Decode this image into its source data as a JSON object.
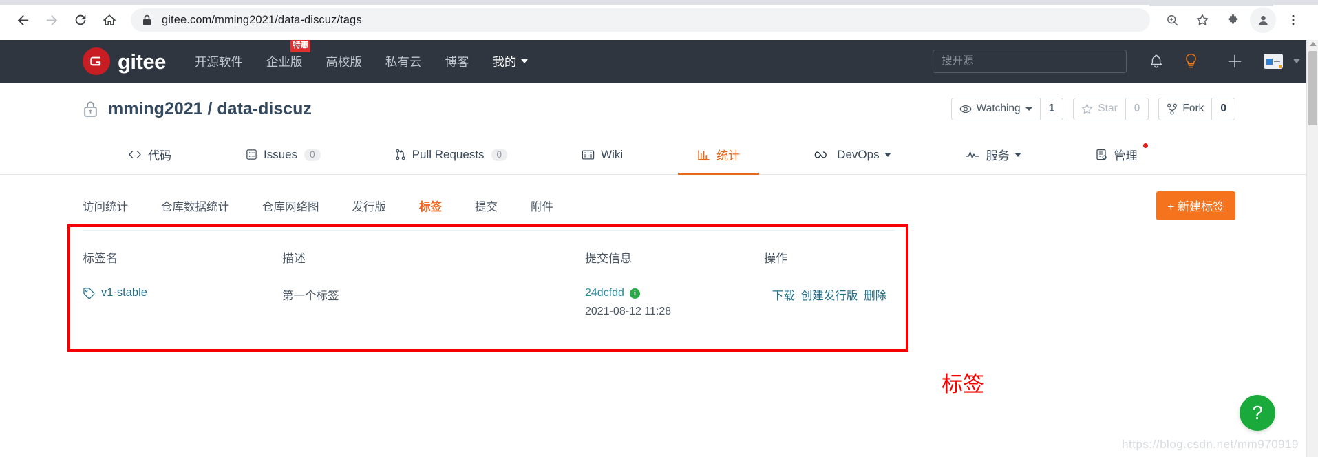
{
  "browser": {
    "back_icon": "back-arrow-icon",
    "forward_icon": "forward-arrow-icon",
    "reload_icon": "reload-icon",
    "home_icon": "home-icon",
    "lock_icon": "lock-icon",
    "url_domain": "gitee.com",
    "url_path": "/mming2021/data-discuz/tags",
    "url_full": "gitee.com/mming2021/data-discuz/tags",
    "toolbar_icons": [
      "zoom-in-icon",
      "bookmark-star-icon",
      "extensions-puzzle-icon",
      "profile-avatar-icon",
      "chrome-menu-icon"
    ]
  },
  "header": {
    "logo_letter": "G",
    "logo_text": "gitee",
    "nav": [
      {
        "label": "开源软件",
        "badge": null,
        "caret": false,
        "active": false
      },
      {
        "label": "企业版",
        "badge": "特惠",
        "caret": false,
        "active": false
      },
      {
        "label": "高校版",
        "badge": null,
        "caret": false,
        "active": false
      },
      {
        "label": "私有云",
        "badge": null,
        "caret": false,
        "active": false
      },
      {
        "label": "博客",
        "badge": null,
        "caret": false,
        "active": false
      },
      {
        "label": "我的",
        "badge": null,
        "caret": true,
        "active": true
      }
    ],
    "search_placeholder": "搜开源",
    "search_value": "",
    "icons": {
      "bell": "notification-bell-icon",
      "bulb": "lightbulb-icon",
      "plus": "plus-icon",
      "avatar": "user-avatar-icon",
      "avatar_caret": "chevron-down-icon"
    },
    "colors": {
      "bg": "#2f3640",
      "logo": "#c71d23",
      "bulb": "#f07a1a",
      "badge": "#e03030"
    }
  },
  "repo": {
    "lock_icon": "private-lock-icon",
    "owner": "mming2021",
    "separator": "/",
    "name": "data-discuz",
    "title_full": "mming2021 / data-discuz",
    "actions": [
      {
        "icon": "eye-icon",
        "label": "Watching",
        "caret": true,
        "count": "1",
        "disabled": false
      },
      {
        "icon": "star-icon",
        "label": "Star",
        "caret": false,
        "count": "0",
        "disabled": true
      },
      {
        "icon": "fork-icon",
        "label": "Fork",
        "caret": false,
        "count": "0",
        "disabled": false
      }
    ]
  },
  "tabs": [
    {
      "icon": "code-brackets-icon",
      "label": "代码",
      "count": null,
      "active": false,
      "caret": false,
      "dot": false
    },
    {
      "icon": "issues-icon",
      "label": "Issues",
      "count": "0",
      "active": false,
      "caret": false,
      "dot": false
    },
    {
      "icon": "pull-request-icon",
      "label": "Pull Requests",
      "count": "0",
      "active": false,
      "caret": false,
      "dot": false
    },
    {
      "icon": "wiki-book-icon",
      "label": "Wiki",
      "count": null,
      "active": false,
      "caret": false,
      "dot": false
    },
    {
      "icon": "bar-chart-icon",
      "label": "统计",
      "count": null,
      "active": true,
      "caret": false,
      "dot": false
    },
    {
      "icon": "infinity-icon",
      "label": "DevOps",
      "count": null,
      "active": false,
      "caret": true,
      "dot": false
    },
    {
      "icon": "pulse-icon",
      "label": "服务",
      "count": null,
      "active": false,
      "caret": true,
      "dot": false
    },
    {
      "icon": "manage-icon",
      "label": "管理",
      "count": null,
      "active": false,
      "caret": false,
      "dot": true
    }
  ],
  "subnav": {
    "items": [
      {
        "label": "访问统计",
        "active": false
      },
      {
        "label": "仓库数据统计",
        "active": false
      },
      {
        "label": "仓库网络图",
        "active": false
      },
      {
        "label": "发行版",
        "active": false
      },
      {
        "label": "标签",
        "active": true
      },
      {
        "label": "提交",
        "active": false
      },
      {
        "label": "附件",
        "active": false
      }
    ],
    "new_tag_button": "+ 新建标签"
  },
  "table": {
    "headers": [
      "标签名",
      "描述",
      "提交信息",
      "操作"
    ],
    "rows": [
      {
        "tag_icon": "tag-icon",
        "tag_name": "v1-stable",
        "description": "第一个标签",
        "commit_hash": "24dcfdd",
        "commit_badge": "i",
        "commit_date": "2021-08-12 11:28",
        "operations": [
          "下载",
          "创建发行版",
          "删除"
        ]
      }
    ]
  },
  "annotation": {
    "text": "标签",
    "color": "#ff0000",
    "highlight_color": "#f50000"
  },
  "footer": {
    "watermark": "https://blog.csdn.net/mm970919",
    "help_button": "?",
    "help_color": "#1aaa3c"
  }
}
